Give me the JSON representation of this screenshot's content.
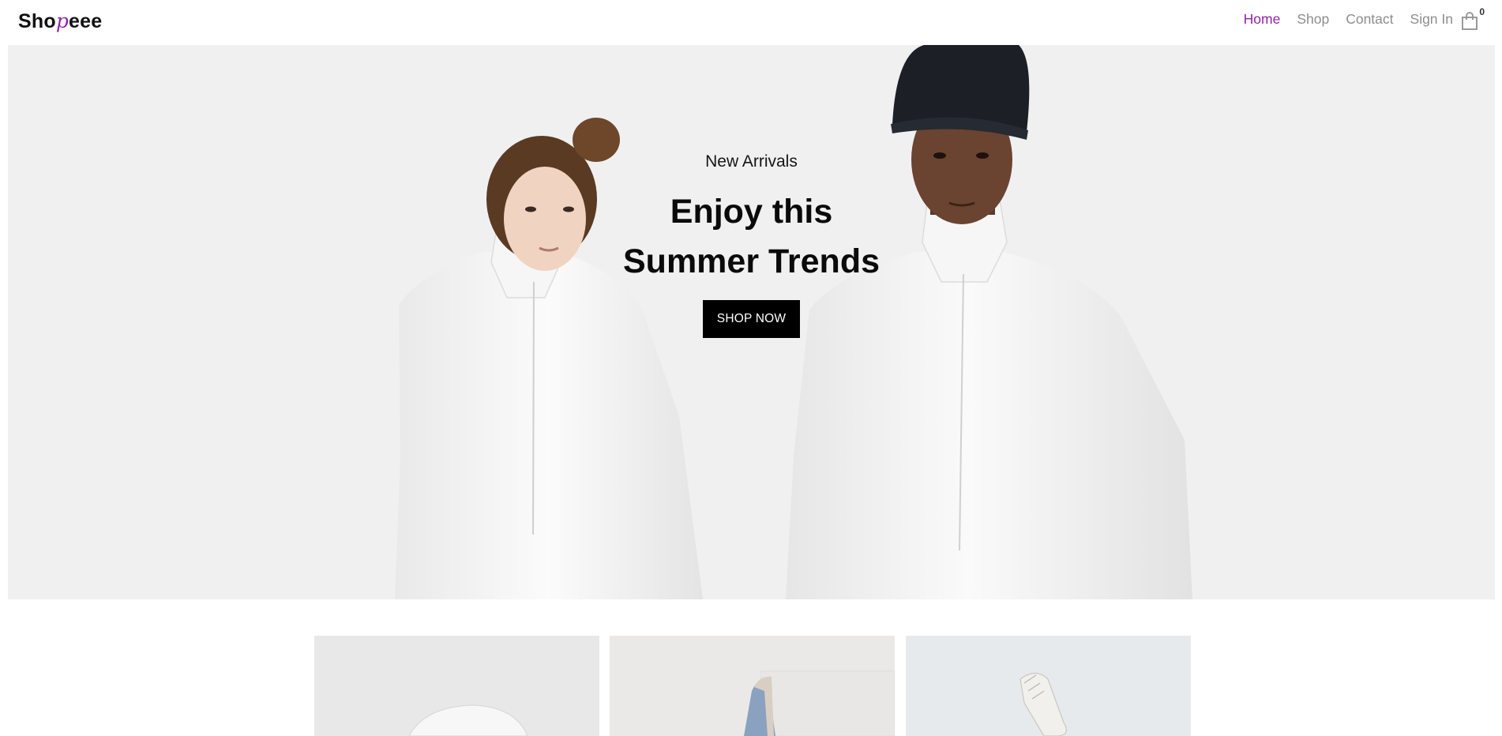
{
  "brand": {
    "prefix": "Sho",
    "accent": "p",
    "suffix": "eee",
    "accent_color": "#8e24aa"
  },
  "nav": {
    "items": [
      {
        "label": "Home",
        "active": true
      },
      {
        "label": "Shop",
        "active": false
      },
      {
        "label": "Contact",
        "active": false
      },
      {
        "label": "Sign In",
        "active": false
      }
    ],
    "cart_icon": "shopping-bag-icon",
    "cart_count": "0"
  },
  "hero": {
    "subtitle": "New Arrivals",
    "title_line1": "Enjoy this",
    "title_line2": "Summer Trends",
    "cta_label": "SHOP NOW",
    "background_color": "#f0f0f1"
  },
  "categories": [
    {
      "image": "white-cap-photo"
    },
    {
      "image": "denim-jacket-photo"
    },
    {
      "image": "white-sneaker-photo"
    }
  ]
}
